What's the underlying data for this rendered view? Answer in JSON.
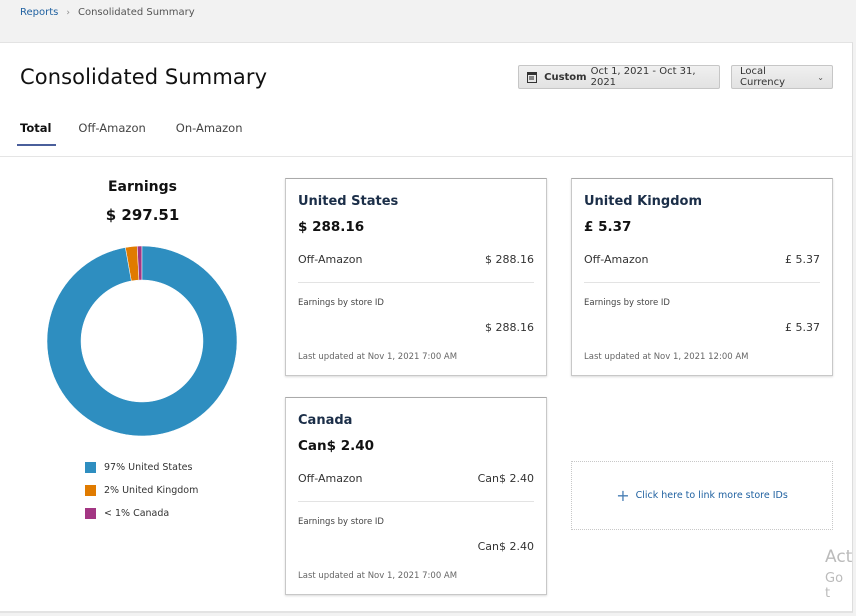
{
  "breadcrumb": {
    "items": [
      "Reports",
      "Consolidated Summary"
    ],
    "separator": "›"
  },
  "page": {
    "title": "Consolidated Summary",
    "date_button": {
      "prefix": "Custom",
      "range": "Oct 1, 2021 - Oct 31, 2021",
      "icon": "calendar-icon"
    },
    "currency_dropdown": {
      "selected": "Local Currency",
      "icon": "chevron-down-icon"
    },
    "tabs": [
      {
        "label": "Total",
        "active": true
      },
      {
        "label": "Off-Amazon",
        "active": false
      },
      {
        "label": "On-Amazon",
        "active": false
      }
    ]
  },
  "earnings": {
    "title": "Earnings",
    "total": "$ 297.51",
    "legend": [
      {
        "label": "97% United States",
        "color": "#2e8ec0"
      },
      {
        "label": "2% United Kingdom",
        "color": "#e07b00"
      },
      {
        "label": "< 1% Canada",
        "color": "#a33683"
      }
    ]
  },
  "chart_data": {
    "type": "pie",
    "variant": "donut",
    "title": "Earnings",
    "categories": [
      "United States",
      "United Kingdom",
      "Canada"
    ],
    "values": [
      97,
      2,
      0.8
    ],
    "unit": "percent",
    "colors": [
      "#2e8ec0",
      "#e07b00",
      "#a33683"
    ],
    "legend_position": "bottom"
  },
  "cards": [
    {
      "country": "United States",
      "total": "$ 288.16",
      "off_amazon_label": "Off-Amazon",
      "off_amazon_value": "$ 288.16",
      "store_label": "Earnings by store ID",
      "store_value": "$ 288.16",
      "updated": "Last updated at Nov 1, 2021 7:00 AM"
    },
    {
      "country": "United Kingdom",
      "total": "£ 5.37",
      "off_amazon_label": "Off-Amazon",
      "off_amazon_value": "£ 5.37",
      "store_label": "Earnings by store ID",
      "store_value": "£ 5.37",
      "updated": "Last updated at Nov 1, 2021 12:00 AM"
    },
    {
      "country": "Canada",
      "total": "Can$ 2.40",
      "off_amazon_label": "Off-Amazon",
      "off_amazon_value": "Can$ 2.40",
      "store_label": "Earnings by store ID",
      "store_value": "Can$ 2.40",
      "updated": "Last updated at Nov 1, 2021 7:00 AM"
    }
  ],
  "link_store": {
    "label": "Click here to link more store IDs",
    "icon": "plus-icon"
  },
  "watermark": {
    "line1": "Act",
    "line2": "Go t"
  }
}
